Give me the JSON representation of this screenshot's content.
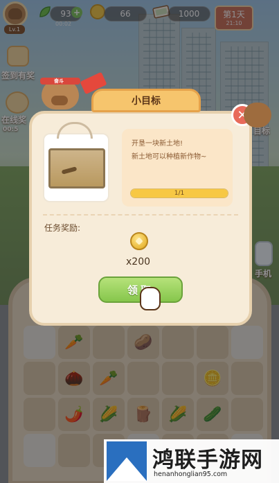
{
  "hud": {
    "level": "Lv.1",
    "energy": "93",
    "energy_timer": "00:02",
    "coins": "66",
    "money": "1000",
    "day": "第1天",
    "clock": "21:10"
  },
  "side": {
    "checkin_label": "签到有奖",
    "online_label": "在线奖",
    "online_timer": "00:5",
    "goal_label": "目标",
    "phone_label": "手机"
  },
  "dialog": {
    "title": "小目标",
    "close_symbol": "✕",
    "task_line1": "开垦一块新土地!",
    "task_line2": "新土地可以种植新作物~",
    "progress_text": "1/1",
    "progress_fraction": 1.0,
    "reward_label": "任务奖励:",
    "reward_amount": "x200",
    "claim_label": "领取"
  },
  "headband_text": "奋斗",
  "grid_items": [
    "",
    "🥕",
    "",
    "🥔",
    "",
    "",
    "",
    "",
    "🌰",
    "🥕",
    "",
    "",
    "🪙",
    "",
    "",
    "🌶️",
    "🌽",
    "🪵",
    "🌽",
    "🥒",
    "",
    "",
    "",
    "",
    "",
    "",
    "",
    ""
  ],
  "watermark": {
    "title": "鸿联手游网",
    "url": "henanhonglian95.com"
  },
  "colors": {
    "dialog_bg": "#f7ecd9",
    "claim_green": "#86c64c",
    "ribbon_orange": "#f6c56d",
    "close_red": "#e86a5a"
  }
}
